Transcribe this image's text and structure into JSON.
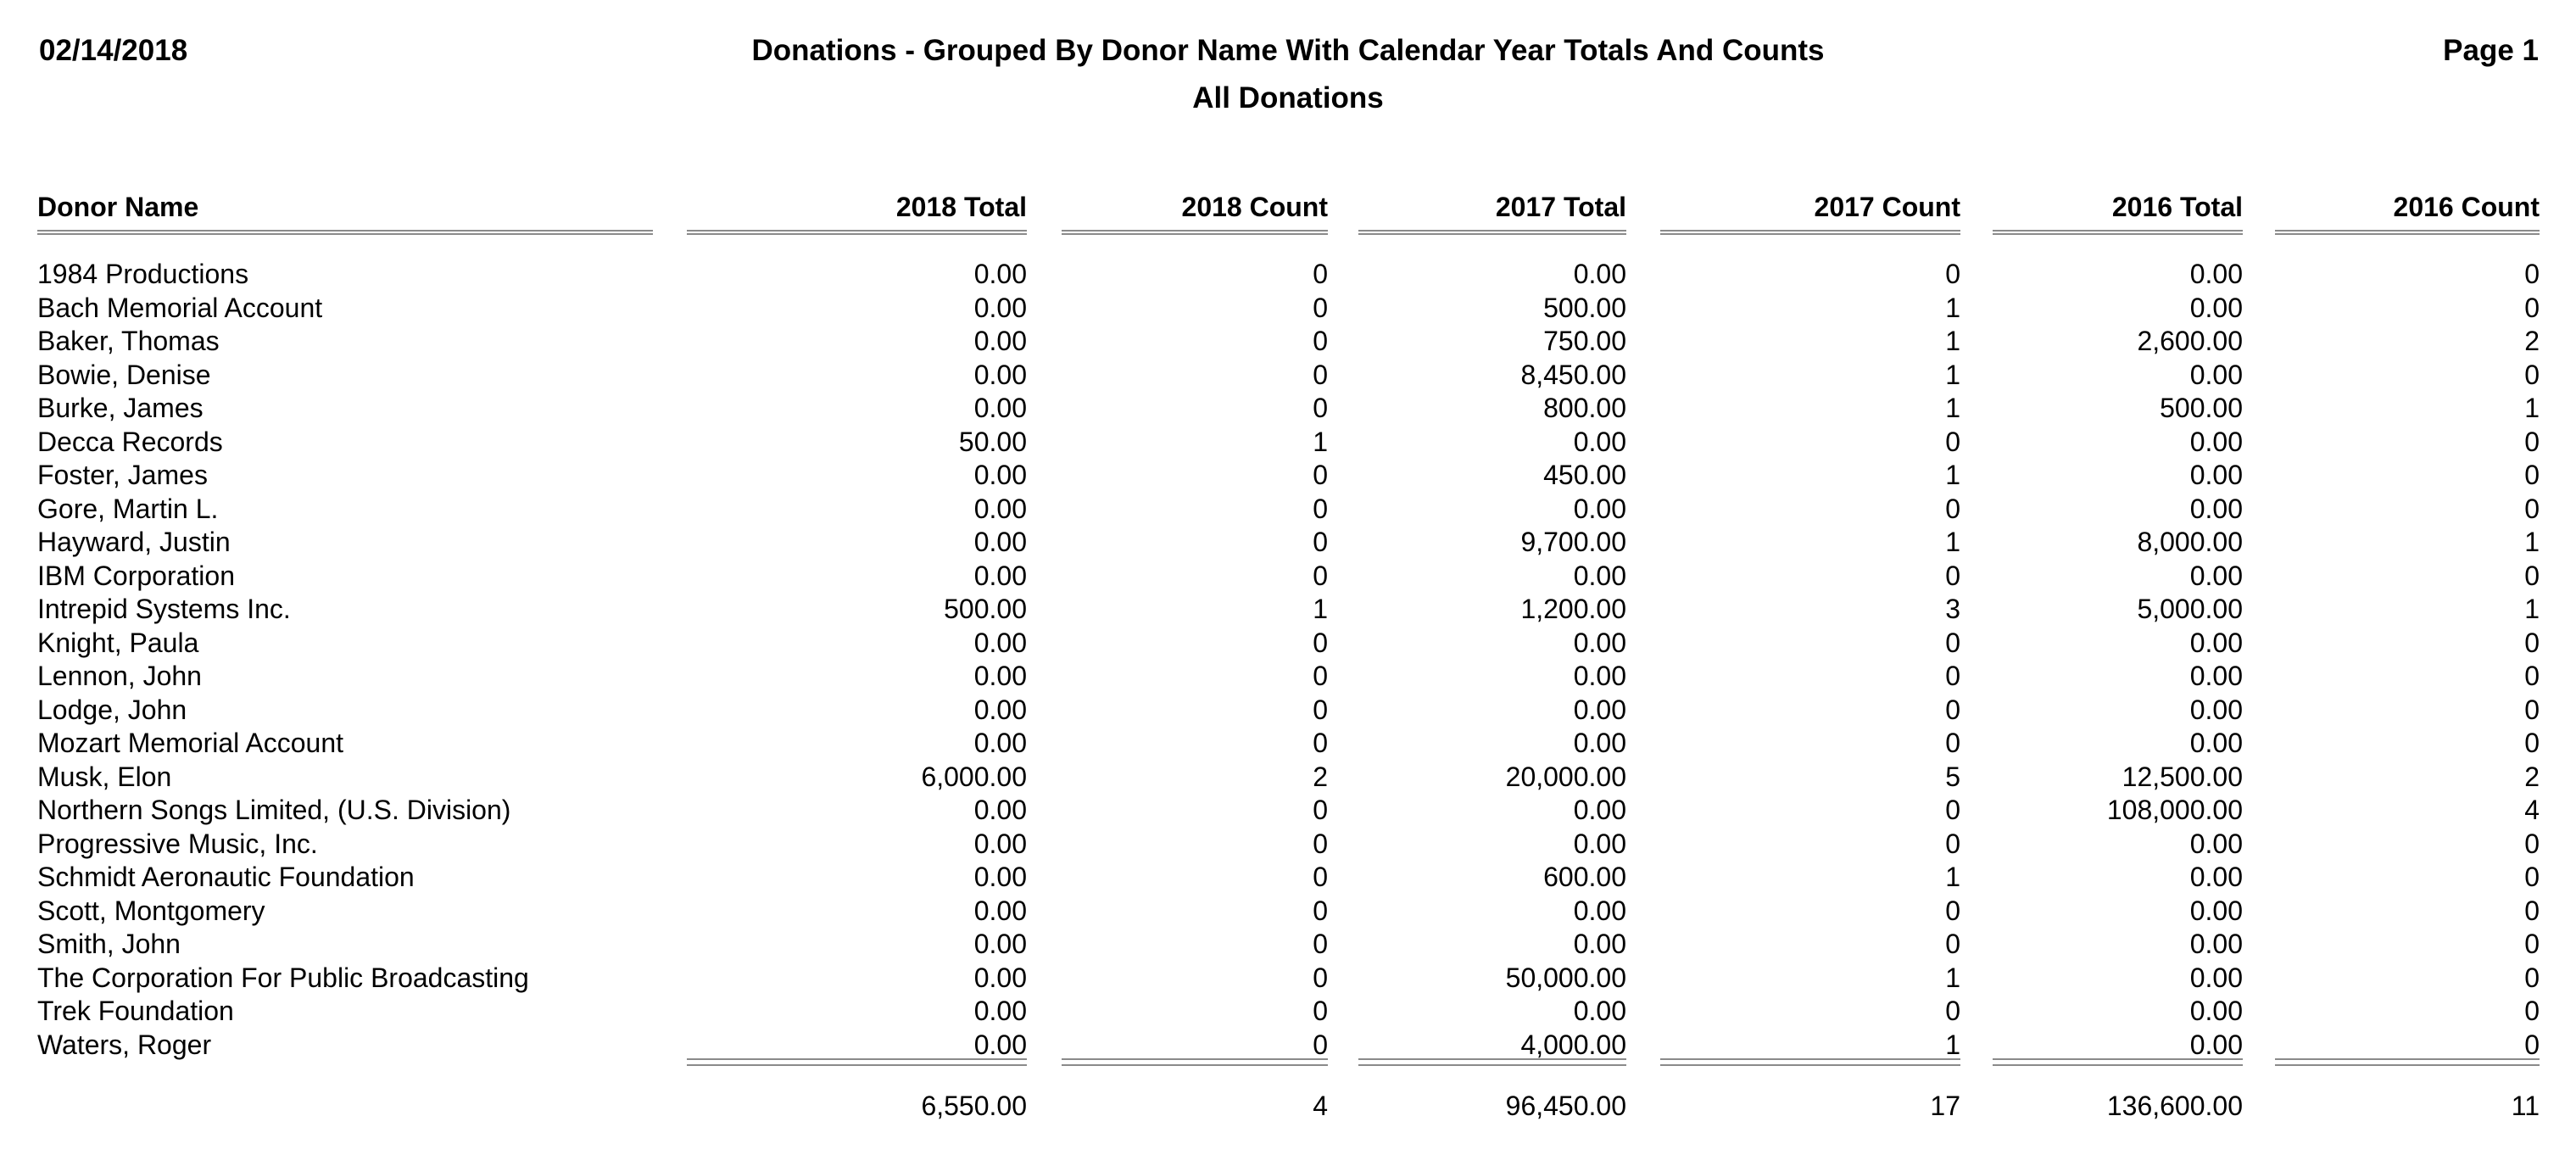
{
  "header": {
    "date": "02/14/2018",
    "title": "Donations - Grouped By Donor Name With Calendar Year Totals And Counts",
    "subtitle": "All Donations",
    "page": "Page 1"
  },
  "columns": [
    {
      "key": "donor",
      "label": "Donor Name"
    },
    {
      "key": "t2018",
      "label": "2018 Total"
    },
    {
      "key": "c2018",
      "label": "2018 Count"
    },
    {
      "key": "t2017",
      "label": "2017 Total"
    },
    {
      "key": "c2017",
      "label": "2017 Count"
    },
    {
      "key": "t2016",
      "label": "2016 Total"
    },
    {
      "key": "c2016",
      "label": "2016 Count"
    }
  ],
  "rows": [
    [
      "1984 Productions",
      "0.00",
      "0",
      "0.00",
      "0",
      "0.00",
      "0"
    ],
    [
      "Bach Memorial Account",
      "0.00",
      "0",
      "500.00",
      "1",
      "0.00",
      "0"
    ],
    [
      "Baker, Thomas",
      "0.00",
      "0",
      "750.00",
      "1",
      "2,600.00",
      "2"
    ],
    [
      "Bowie, Denise",
      "0.00",
      "0",
      "8,450.00",
      "1",
      "0.00",
      "0"
    ],
    [
      "Burke, James",
      "0.00",
      "0",
      "800.00",
      "1",
      "500.00",
      "1"
    ],
    [
      "Decca Records",
      "50.00",
      "1",
      "0.00",
      "0",
      "0.00",
      "0"
    ],
    [
      "Foster, James",
      "0.00",
      "0",
      "450.00",
      "1",
      "0.00",
      "0"
    ],
    [
      "Gore, Martin L.",
      "0.00",
      "0",
      "0.00",
      "0",
      "0.00",
      "0"
    ],
    [
      "Hayward, Justin",
      "0.00",
      "0",
      "9,700.00",
      "1",
      "8,000.00",
      "1"
    ],
    [
      "IBM Corporation",
      "0.00",
      "0",
      "0.00",
      "0",
      "0.00",
      "0"
    ],
    [
      "Intrepid Systems Inc.",
      "500.00",
      "1",
      "1,200.00",
      "3",
      "5,000.00",
      "1"
    ],
    [
      "Knight, Paula",
      "0.00",
      "0",
      "0.00",
      "0",
      "0.00",
      "0"
    ],
    [
      "Lennon, John",
      "0.00",
      "0",
      "0.00",
      "0",
      "0.00",
      "0"
    ],
    [
      "Lodge, John",
      "0.00",
      "0",
      "0.00",
      "0",
      "0.00",
      "0"
    ],
    [
      "Mozart Memorial Account",
      "0.00",
      "0",
      "0.00",
      "0",
      "0.00",
      "0"
    ],
    [
      "Musk, Elon",
      "6,000.00",
      "2",
      "20,000.00",
      "5",
      "12,500.00",
      "2"
    ],
    [
      "Northern Songs Limited, (U.S. Division)",
      "0.00",
      "0",
      "0.00",
      "0",
      "108,000.00",
      "4"
    ],
    [
      "Progressive Music, Inc.",
      "0.00",
      "0",
      "0.00",
      "0",
      "0.00",
      "0"
    ],
    [
      "Schmidt Aeronautic Foundation",
      "0.00",
      "0",
      "600.00",
      "1",
      "0.00",
      "0"
    ],
    [
      "Scott, Montgomery",
      "0.00",
      "0",
      "0.00",
      "0",
      "0.00",
      "0"
    ],
    [
      "Smith, John",
      "0.00",
      "0",
      "0.00",
      "0",
      "0.00",
      "0"
    ],
    [
      "The Corporation For Public Broadcasting",
      "0.00",
      "0",
      "50,000.00",
      "1",
      "0.00",
      "0"
    ],
    [
      "Trek Foundation",
      "0.00",
      "0",
      "0.00",
      "0",
      "0.00",
      "0"
    ],
    [
      "Waters, Roger",
      "0.00",
      "0",
      "4,000.00",
      "1",
      "0.00",
      "0"
    ]
  ],
  "totals": [
    "",
    "6,550.00",
    "4",
    "96,450.00",
    "17",
    "136,600.00",
    "11"
  ],
  "colors": {
    "text": "#000000",
    "rule": "#8a8a8a",
    "background": "#ffffff"
  }
}
